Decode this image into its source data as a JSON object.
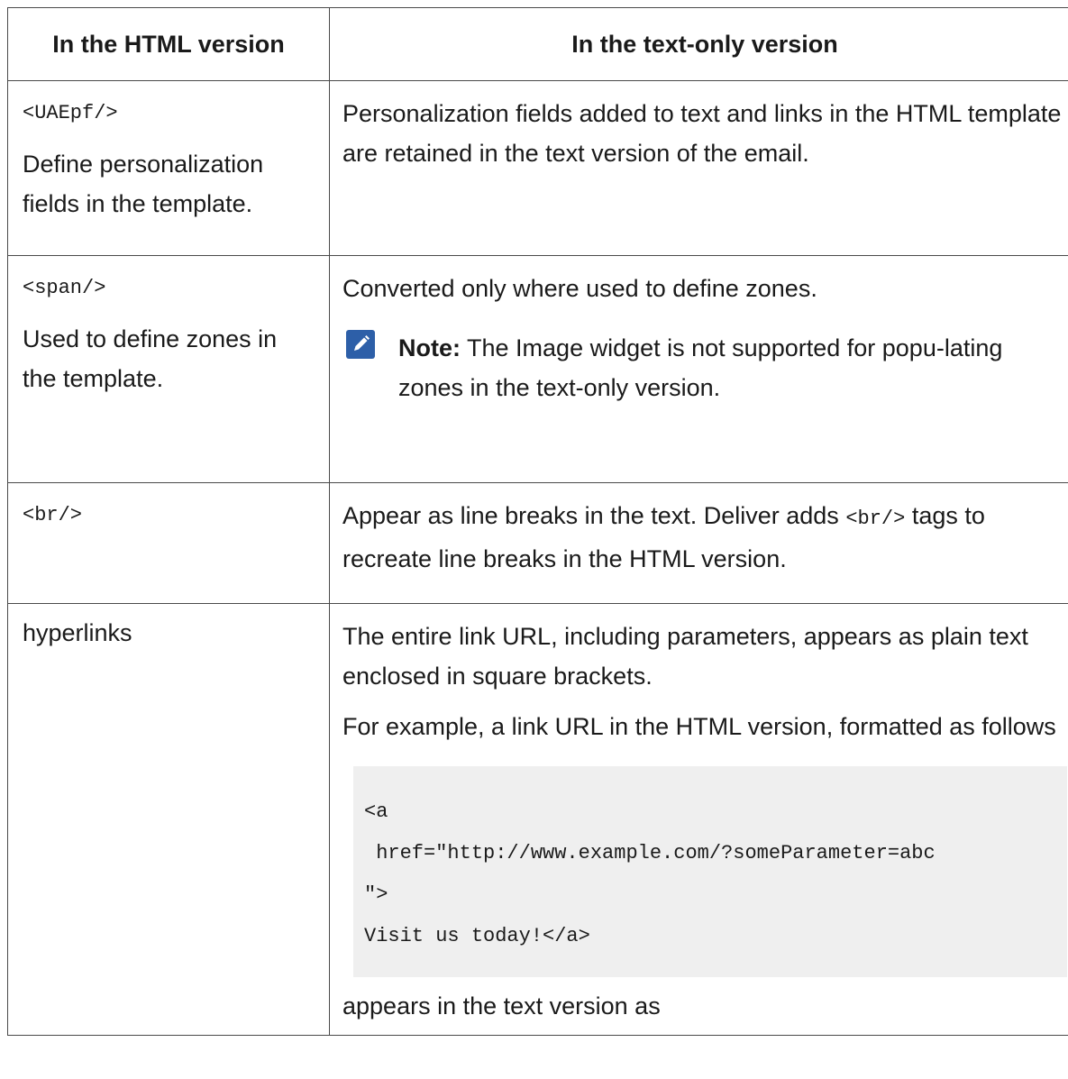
{
  "header": {
    "col1": "In the HTML version",
    "col2": "In the text-only version"
  },
  "rows": [
    {
      "tag": "<UAEpf/>",
      "desc": "Define personalization fields in the template.",
      "text": "Personalization fields added to text and links in the HTML template are retained in the text version of the email."
    },
    {
      "tag": "<span/>",
      "desc": "Used to define zones in the template.",
      "text": "Converted only where used to define zones.",
      "note_label": "Note:",
      "note_text": "The Image widget is not supported for popu-lating zones in the text-only version.",
      "note_icon": "pencil-icon"
    },
    {
      "tag": "<br/>",
      "text_before": "Appear as line breaks in the text. Deliver adds ",
      "text_code": "<br/>",
      "text_after": " tags to recreate line breaks in the HTML version."
    },
    {
      "tag": "hyperlinks",
      "para1": "The entire link URL, including parameters, appears as plain text enclosed in square brackets.",
      "para2": "For example, a link URL in the HTML version, formatted as follows",
      "code_lines": [
        "<a",
        " href=\"http://www.example.com/?someParameter=abc",
        "\">",
        "Visit us today!</a>"
      ],
      "para3": "appears in the text version as"
    }
  ],
  "colors": {
    "note_icon_bg": "#2d5fa8",
    "code_bg": "#efefef",
    "border": "#4a4a4a"
  }
}
